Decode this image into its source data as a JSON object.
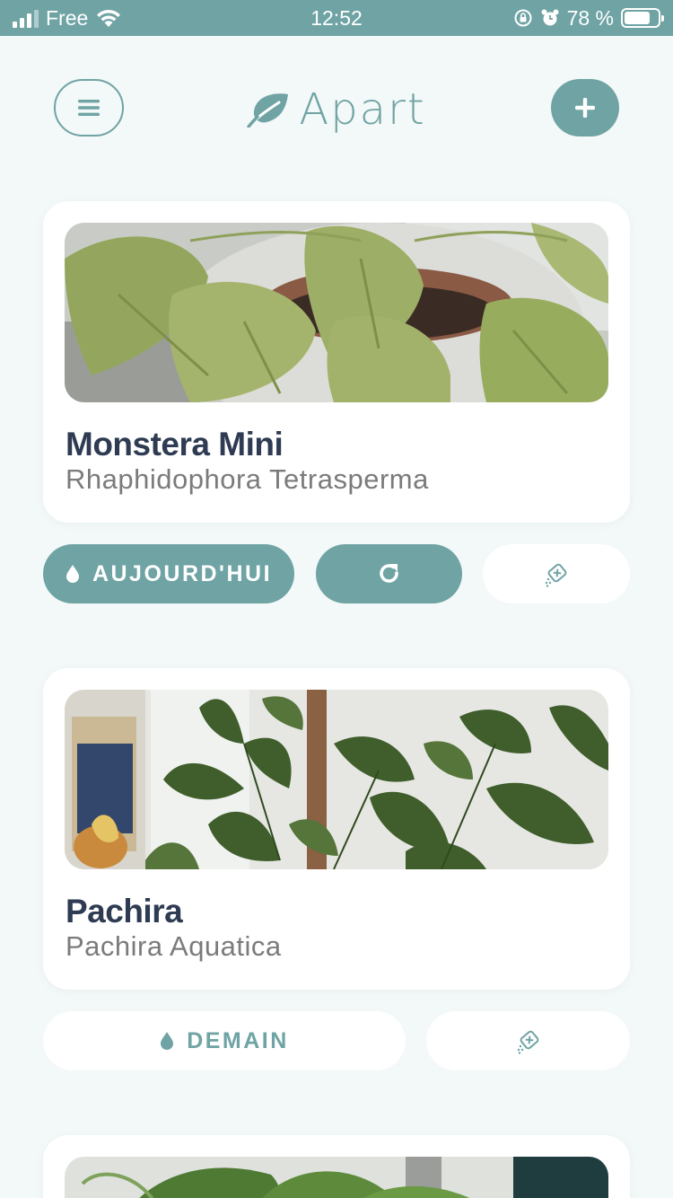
{
  "status_bar": {
    "carrier": "Free",
    "time": "12:52",
    "battery_percent": "78 %",
    "battery_level": 0.78
  },
  "header": {
    "brand": "Apart",
    "menu_icon": "hamburger-menu-icon",
    "add_icon": "plus-icon",
    "logo_icon": "leaf-icon"
  },
  "colors": {
    "accent": "#6fa3a4",
    "background": "#f3f8f8",
    "card": "#ffffff",
    "title": "#2e3b52",
    "subtitle": "#7b7b7b"
  },
  "plants": [
    {
      "name": "Monstera Mini",
      "species": "Rhaphidophora Tetrasperma",
      "water_label": "AUJOURD'HUI",
      "water_icon": "water-drop-icon",
      "repeat_icon": "refresh-icon",
      "fertilizer_icon": "fertilizer-icon"
    },
    {
      "name": "Pachira",
      "species": "Pachira Aquatica",
      "water_label": "DEMAIN",
      "water_icon": "water-drop-icon",
      "fertilizer_icon": "fertilizer-icon"
    }
  ]
}
